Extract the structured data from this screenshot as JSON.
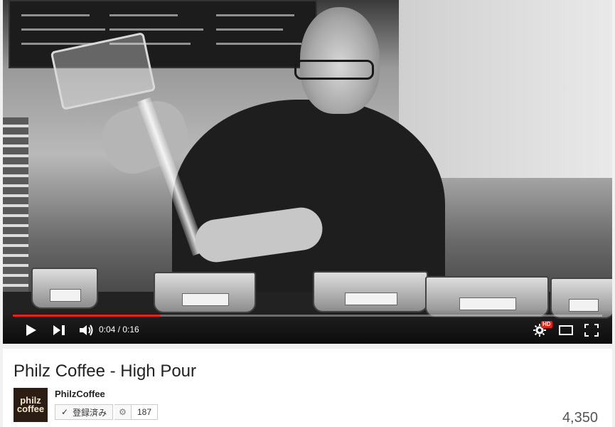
{
  "player": {
    "progress": 0.25,
    "time_text": "0:04 / 0:16",
    "hd_label": "HD",
    "icons": {
      "play": "play-icon",
      "next": "next-icon",
      "volume": "volume-icon",
      "settings": "gear-icon",
      "theater": "theater-mode-icon",
      "fullscreen": "fullscreen-icon"
    },
    "colors": {
      "progress_fill": "#e62117",
      "hd_badge": "#e62117"
    }
  },
  "video": {
    "title": "Philz Coffee - High Pour"
  },
  "channel": {
    "name": "PhilzCoffee",
    "subscribe_label": "登録済み",
    "subscriber_count": "187",
    "logo_text_1": "philz",
    "logo_text_2": "coffee"
  },
  "stats": {
    "views": "4,350"
  }
}
